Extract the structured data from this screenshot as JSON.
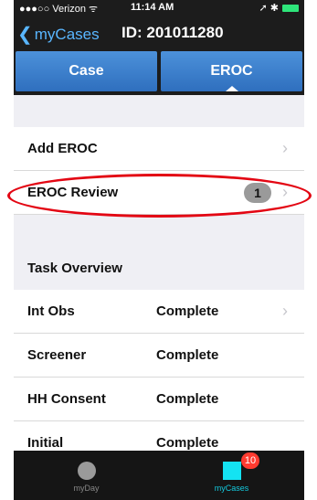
{
  "status_bar": {
    "carrier": "●●●○○ Verizon ᯤ",
    "time": "11:14 AM",
    "right_icons": "➚ ✱"
  },
  "nav": {
    "back_label": "myCases",
    "title": "ID: 201011280"
  },
  "tabs": [
    {
      "label": "Case"
    },
    {
      "label": "EROC"
    }
  ],
  "rows": {
    "add_eroc": "Add EROC",
    "eroc_review": "EROC Review",
    "eroc_review_badge": "1"
  },
  "task_overview": {
    "header": "Task Overview",
    "items": [
      {
        "label": "Int Obs",
        "value": "Complete"
      },
      {
        "label": "Screener",
        "value": "Complete"
      },
      {
        "label": "HH Consent",
        "value": "Complete"
      },
      {
        "label": "Initial",
        "value": "Complete"
      }
    ]
  },
  "tabbar": {
    "items": [
      {
        "label": "myDay"
      },
      {
        "label": "myCases"
      }
    ],
    "cases_badge": "10"
  },
  "colors": {
    "accent": "#2f6fbe",
    "highlight": "#e30613",
    "active_tab": "#14e3f2"
  }
}
